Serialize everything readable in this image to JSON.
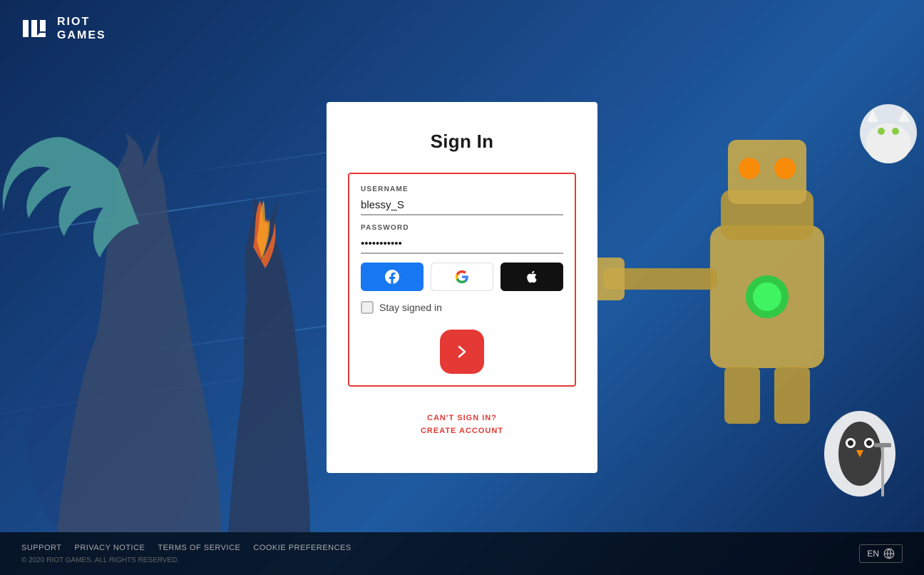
{
  "brand": {
    "logo_line1": "RIOT",
    "logo_line2": "GAMES"
  },
  "signin": {
    "title": "Sign In",
    "username_label": "USERNAME",
    "username_value": "blessy_S",
    "password_label": "PASSWORD",
    "password_value": "············",
    "stay_signed_in": "Stay signed in",
    "cant_sign_in": "CAN'T SIGN IN?",
    "create_account": "CREATE ACCOUNT"
  },
  "social": {
    "facebook_label": "Facebook",
    "google_label": "Google",
    "apple_label": "Apple"
  },
  "footer": {
    "support": "SUPPORT",
    "privacy": "PRIVACY NOTICE",
    "terms": "TERMS OF SERVICE",
    "cookie": "COOKIE PREFERENCES",
    "lang": "EN",
    "copyright": "© 2020 RIOT GAMES. ALL RIGHTS RESERVED."
  }
}
